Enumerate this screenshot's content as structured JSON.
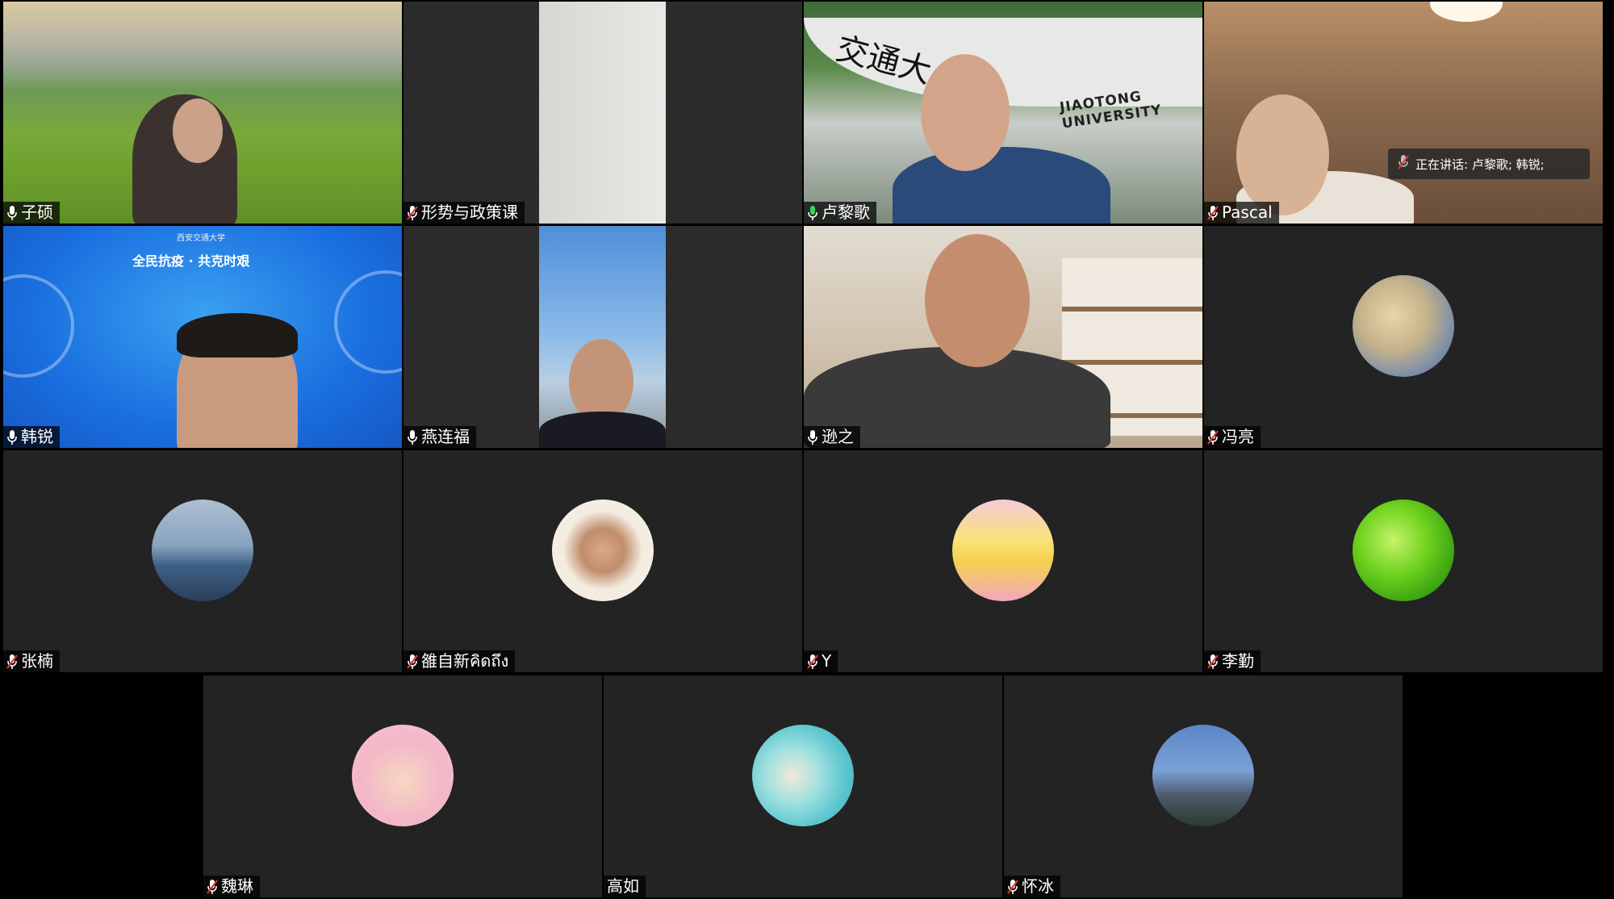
{
  "participants": [
    {
      "name": "子硕",
      "mic": "on"
    },
    {
      "name": "形势与政策课",
      "mic": "muted"
    },
    {
      "name": "卢黎歌",
      "mic": "active"
    },
    {
      "name": "Pascal",
      "mic": "muted"
    },
    {
      "name": "韩锐",
      "mic": "on"
    },
    {
      "name": "燕连福",
      "mic": "on"
    },
    {
      "name": "逊之",
      "mic": "on"
    },
    {
      "name": "冯亮",
      "mic": "muted"
    },
    {
      "name": "张楠",
      "mic": "muted"
    },
    {
      "name": "雒自新คิดถึง",
      "mic": "muted"
    },
    {
      "name": "Y",
      "mic": "muted"
    },
    {
      "name": "李勤",
      "mic": "muted"
    },
    {
      "name": "魏琳",
      "mic": "muted"
    },
    {
      "name": "高如",
      "mic": "none"
    },
    {
      "name": "怀冰",
      "mic": "muted"
    }
  ],
  "speaking_indicator": "正在讲话: 卢黎歌; 韩锐;",
  "backgrounds": {
    "jiaotong_sign": "JIAOTONG UNIVERSITY",
    "jiaotong_calligraphy": "交通大",
    "banner_text": "全民抗疫 · 共克时艰",
    "banner_top": "西安交通大学"
  },
  "colors": {
    "tile_bg": "#232323",
    "active_mic": "#3fd25a",
    "muted_mic": "#e0352b"
  }
}
